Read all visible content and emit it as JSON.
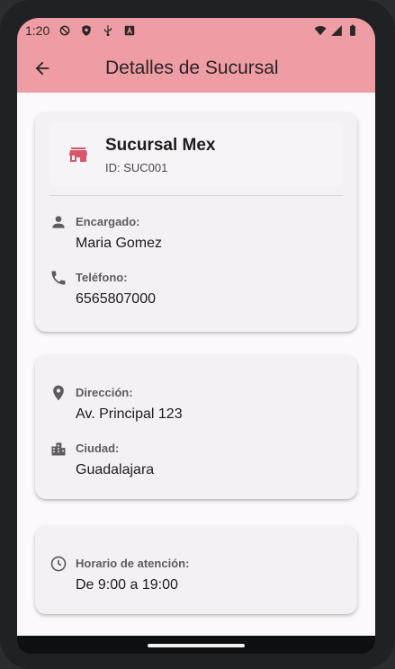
{
  "status_bar": {
    "time": "1:20",
    "icons": [
      "do-not-disturb-icon",
      "shield-icon",
      "usb-icon",
      "a-icon"
    ],
    "right_icons": [
      "wifi-icon",
      "signal-icon",
      "battery-icon"
    ]
  },
  "app_bar": {
    "title": "Detalles de Sucursal",
    "back_icon": "arrow-back-icon",
    "color": "#ef9da4"
  },
  "branch": {
    "name": "Sucursal Mex",
    "id_text": "ID: SUC001",
    "icon": "store-icon",
    "icon_color": "#d9576a"
  },
  "fields": {
    "manager": {
      "label": "Encargado:",
      "value": "Maria Gomez",
      "icon": "person-icon"
    },
    "phone": {
      "label": "Teléfono:",
      "value": "6565807000",
      "icon": "phone-icon"
    },
    "address": {
      "label": "Dirección:",
      "value": "Av. Principal 123",
      "icon": "location-pin-icon"
    },
    "city": {
      "label": "Ciudad:",
      "value": "Guadalajara",
      "icon": "city-icon"
    },
    "hours": {
      "label": "Horario de atención:",
      "value": "De 9:00 a 19:00",
      "icon": "clock-icon"
    }
  }
}
